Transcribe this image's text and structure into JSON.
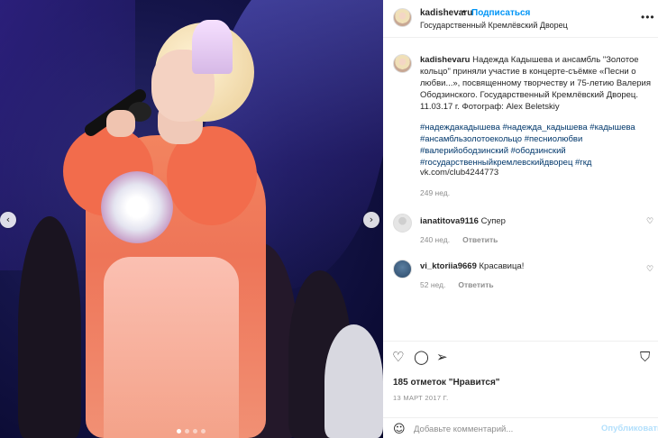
{
  "photo": {
    "nav_prev": "‹",
    "nav_next": "›",
    "slide_count": 4,
    "active_slide": 0
  },
  "header": {
    "username": "kadishevaru",
    "separator": "•",
    "follow": "Подписаться",
    "location": "Государственный Кремлёвский Дворец",
    "more": "•••"
  },
  "caption": {
    "username": "kadishevaru",
    "text": "Надежда Кадышева и ансамбль \"Золотое кольцо\" приняли участие в концерте-съёмке «Песни о любви...», посвященному творчеству и 75-летию Валерия Ободзинского. Государственный Кремлёвский Дворец. 11.03.17 г. Фотограф: Alex Beletskiy",
    "hashtags": "#надеждакадышева #надежда_кадышева #кадышева #ансамбльзолотоекольцо #песниолюбви #валерийободзинский #ободзинский #государственныйкремлевскийдворец #гкд",
    "link": "vk.com/club4244773",
    "time": "249 нед."
  },
  "comments": [
    {
      "username": "ianatitova9116",
      "text": "Супер",
      "time": "240 нед.",
      "reply": "Ответить"
    },
    {
      "username": "vi_ktoriia9669",
      "text": "Красавица!",
      "time": "52 нед.",
      "reply": "Ответить"
    }
  ],
  "actions": {
    "likes": "185 отметок \"Нравится\"",
    "date": "13 МАРТ 2017 Г.",
    "comment_placeholder": "Добавьте комментарий...",
    "publish": "Опубликовать"
  },
  "colors": {
    "link_blue": "#0095f6",
    "hashtag": "#00376b",
    "publish_disabled": "#b2dffc",
    "muted": "#8e8e8e"
  }
}
